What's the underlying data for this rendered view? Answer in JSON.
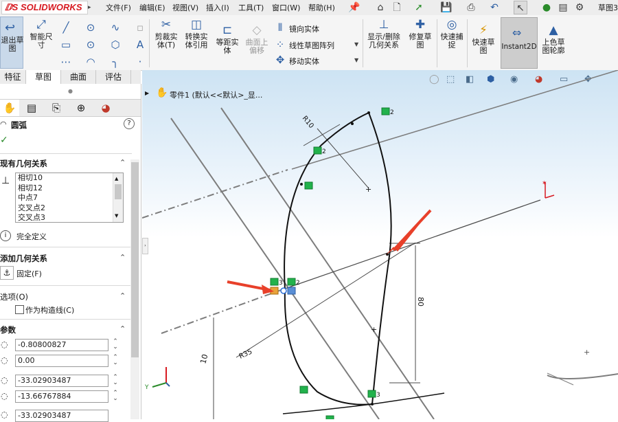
{
  "app": {
    "logo_text": "SOLIDWORKS"
  },
  "menu": [
    "文件(F)",
    "编辑(E)",
    "视图(V)",
    "插入(I)",
    "工具(T)",
    "窗口(W)",
    "帮助(H)"
  ],
  "right_title": "草图3",
  "commands": {
    "exit_sketch": "退出草图",
    "smart_dim": "智能尺寸",
    "trim": "剪裁实体(T)",
    "convert": "转换实体引用",
    "offset": "等距实体",
    "surface_offset": "曲面上偏移",
    "mirror": "镜向实体",
    "linear_pattern": "线性草图阵列",
    "move": "移动实体",
    "display_relations": "显示/删除几何关系",
    "repair": "修复草图",
    "quick_snap": "快速捕捉",
    "rapid_sketch": "快速草图",
    "instant2d": "Instant2D",
    "shaded": "上色草图轮廓"
  },
  "tabs": [
    "特征",
    "草图",
    "曲面",
    "评估"
  ],
  "feature_tree": {
    "part_label": "零件1  (默认<<默认>_显..."
  },
  "property_manager": {
    "title": "圆弧",
    "existing_relations": {
      "header": "现有几何关系",
      "items": [
        "相切10",
        "相切12",
        "中点7",
        "交叉点2",
        "交叉点3"
      ]
    },
    "status": "完全定义",
    "add_relations": {
      "header": "添加几何关系",
      "fix_label": "固定(F)"
    },
    "options": {
      "header": "选项(O)",
      "construction_label": "作为构造线(C)"
    },
    "params": {
      "header": "参数",
      "values": [
        "-0.80800827",
        "0.00",
        "-33.02903487",
        "-13.66767884",
        "-33.02903487"
      ]
    }
  },
  "dimensions": {
    "r_small": "R10",
    "r_large": "R35",
    "vertical": "80",
    "left": "10"
  },
  "relation_icons": {
    "count_2": "2",
    "count_3": "3"
  },
  "colors": {
    "accent_red": "#d71920",
    "sketch_black": "#111111",
    "relation_green": "#22b24c",
    "arrow_red": "#e8402a"
  }
}
